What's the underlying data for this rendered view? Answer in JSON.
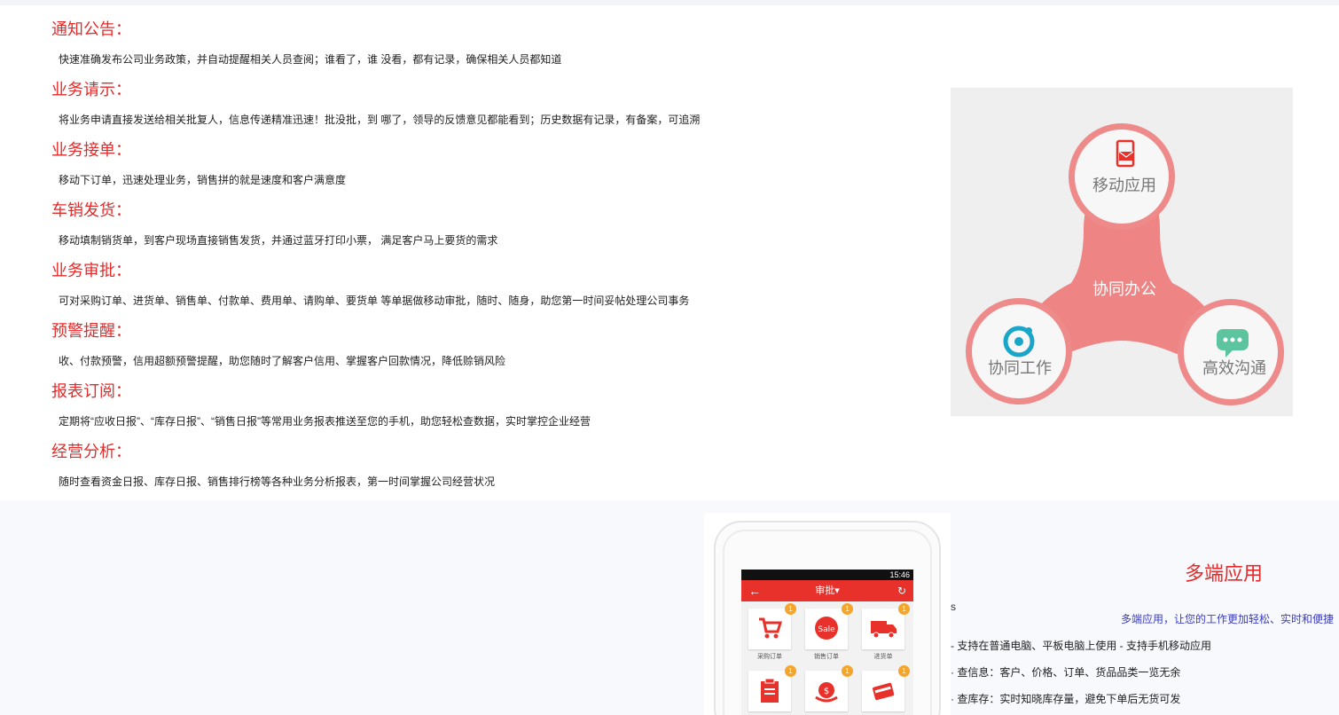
{
  "features": [
    {
      "title": "通知公告：",
      "desc": "快速准确发布公司业务政策，并自动提醒相关人员查阅；谁看了，谁 没看，都有记录，确保相关人员都知道"
    },
    {
      "title": "业务请示：",
      "desc": "将业务申请直接发送给相关批复人，信息传递精准迅速！批没批，到 哪了，领导的反馈意见都能看到；历史数据有记录，有备案，可追溯"
    },
    {
      "title": "业务接单：",
      "desc": "移动下订单，迅速处理业务，销售拼的就是速度和客户满意度"
    },
    {
      "title": "车销发货：",
      "desc": "移动填制销货单，到客户现场直接销售发货，并通过蓝牙打印小票， 满足客户马上要货的需求"
    },
    {
      "title": "业务审批：",
      "desc": "可对采购订单、进货单、销售单、付款单、费用单、请购单、要货单 等单据做移动审批，随时、随身，助您第一时间妥帖处理公司事务"
    },
    {
      "title": "预警提醒：",
      "desc": "收、付款预警，信用超额预警提醒，助您随时了解客户信用、掌握客户回款情况，降低赊销风险"
    },
    {
      "title": "报表订阅：",
      "desc": "定期将“应收日报”、“库存日报”、“销售日报”等常用业务报表推送至您的手机，助您轻松查数据，实时掌控企业经营"
    },
    {
      "title": "经营分析：",
      "desc": "随时查看资金日报、库存日报、销售排行榜等各种业务分析报表，第一时间掌握公司经营状况"
    }
  ],
  "diagram": {
    "center": "协同办公",
    "top": "移动应用",
    "left": "协同工作",
    "right": "高效沟通",
    "colors": {
      "hub": "#ee8484",
      "ring": "#ee8a8a",
      "icon_red": "#e8312a",
      "icon_teal": "#1aa6c8",
      "icon_green": "#5cc5a0"
    }
  },
  "phone": {
    "status_time": "15:46",
    "header_title": "审批▾",
    "tiles": [
      {
        "label": "采购订单",
        "badge": "1",
        "icon": "cart-icon"
      },
      {
        "label": "销售订单",
        "badge": "1",
        "icon": "sale-icon"
      },
      {
        "label": "进货单",
        "badge": "1",
        "icon": "truck-icon"
      },
      {
        "label": "",
        "badge": "1",
        "icon": "clipboard-icon"
      },
      {
        "label": "",
        "badge": "1",
        "icon": "money-bag-icon"
      },
      {
        "label": "",
        "badge": "1",
        "icon": "card-icon"
      }
    ]
  },
  "multi": {
    "title": "多端应用",
    "subtitle": "多端应用，让您的工作更加轻松、实时和便捷",
    "s_label": "s",
    "lines": [
      "- 支持在普通电脑、平板电脑上使用 - 支持手机移动应用",
      "· 查信息：客户、价格、订单、货品品类一览无余",
      "· 查库存：实时知晓库存量，避免下单后无货可发"
    ]
  }
}
